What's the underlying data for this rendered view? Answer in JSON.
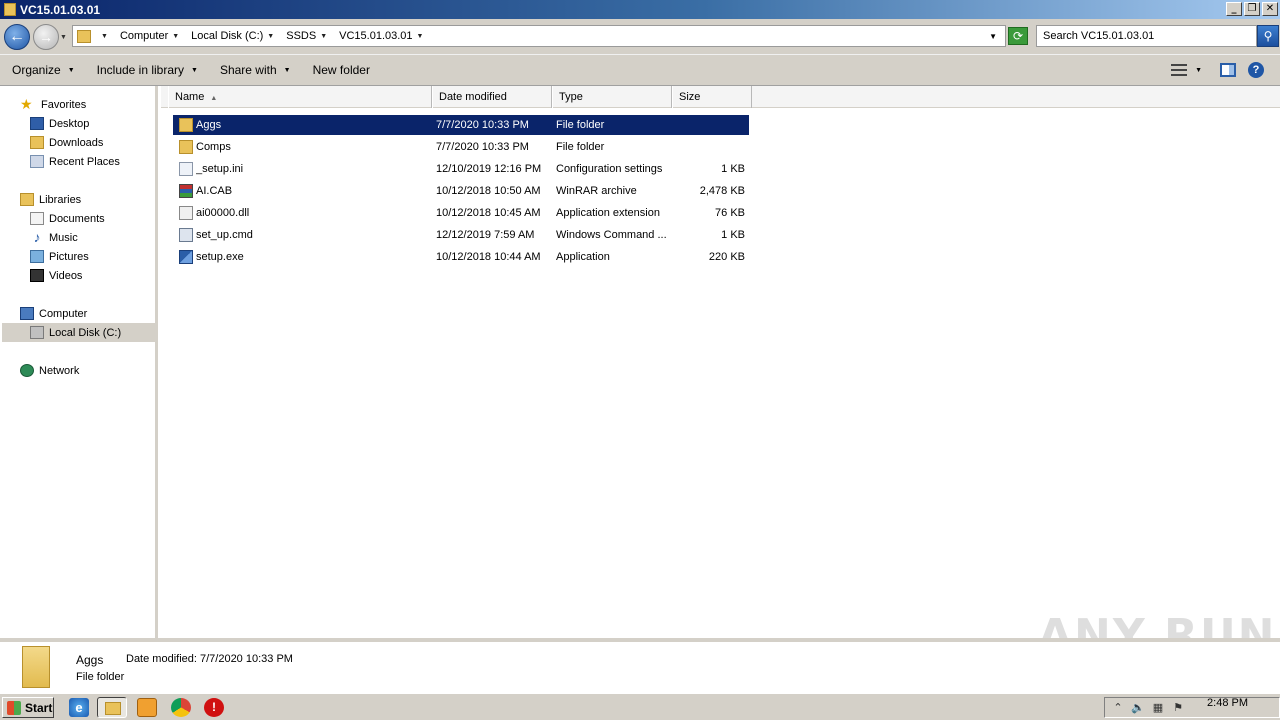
{
  "window": {
    "title": "VC15.01.03.01",
    "min": "_",
    "max": "❐",
    "close": "✕"
  },
  "address": {
    "crumbs": [
      "Computer",
      "Local Disk (C:)",
      "SSDS",
      "VC15.01.03.01"
    ],
    "search_placeholder": "Search VC15.01.03.01"
  },
  "toolbar": {
    "organize": "Organize",
    "include": "Include in library",
    "share": "Share with",
    "new_folder": "New folder"
  },
  "nav": {
    "favorites": "Favorites",
    "desktop": "Desktop",
    "downloads": "Downloads",
    "recent": "Recent Places",
    "libraries": "Libraries",
    "documents": "Documents",
    "music": "Music",
    "pictures": "Pictures",
    "videos": "Videos",
    "computer": "Computer",
    "local_disk": "Local Disk (C:)",
    "network": "Network"
  },
  "columns": {
    "name": "Name",
    "date": "Date modified",
    "type": "Type",
    "size": "Size"
  },
  "files": [
    {
      "name": "Aggs",
      "date": "7/7/2020 10:33 PM",
      "type": "File folder",
      "size": "",
      "icon": "folder-icon"
    },
    {
      "name": "Comps",
      "date": "7/7/2020 10:33 PM",
      "type": "File folder",
      "size": "",
      "icon": "folder-icon"
    },
    {
      "name": "_setup.ini",
      "date": "12/10/2019 12:16 PM",
      "type": "Configuration settings",
      "size": "1 KB",
      "icon": "ini-file-icon"
    },
    {
      "name": "AI.CAB",
      "date": "10/12/2018 10:50 AM",
      "type": "WinRAR archive",
      "size": "2,478 KB",
      "icon": "winrar-archive-icon"
    },
    {
      "name": "ai00000.dll",
      "date": "10/12/2018 10:45 AM",
      "type": "Application extension",
      "size": "76 KB",
      "icon": "dll-file-icon"
    },
    {
      "name": "set_up.cmd",
      "date": "12/12/2019 7:59 AM",
      "type": "Windows Command ...",
      "size": "1 KB",
      "icon": "cmd-file-icon"
    },
    {
      "name": "setup.exe",
      "date": "10/12/2018 10:44 AM",
      "type": "Application",
      "size": "220 KB",
      "icon": "setup-exe-icon"
    }
  ],
  "details": {
    "name": "Aggs",
    "modified_label": "Date modified: 7/7/2020 10:33 PM",
    "type": "File folder"
  },
  "watermark": "ANY RUN",
  "taskbar": {
    "start": "Start",
    "clock": "2:48 PM"
  }
}
